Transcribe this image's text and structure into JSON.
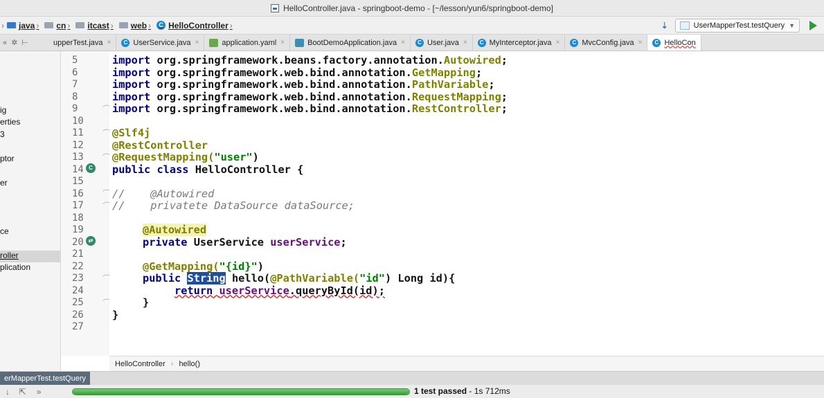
{
  "window": {
    "title": "HelloController.java - springboot-demo - [~/lesson/yun6/springboot-demo]"
  },
  "breadcrumb": [
    {
      "label": "java"
    },
    {
      "label": "cn"
    },
    {
      "label": "itcast"
    },
    {
      "label": "web"
    },
    {
      "label": "HelloController"
    }
  ],
  "run_config": {
    "label": "UserMapperTest.testQuery"
  },
  "tabs": [
    {
      "label": "upperTest.java"
    },
    {
      "label": "UserService.java"
    },
    {
      "label": "application.yaml"
    },
    {
      "label": "BootDemoApplication.java"
    },
    {
      "label": "User.java"
    },
    {
      "label": "MyInterceptor.java"
    },
    {
      "label": "MvcConfig.java"
    },
    {
      "label": "HelloCon"
    }
  ],
  "project_items": [
    {
      "label": "ig"
    },
    {
      "label": "erties"
    },
    {
      "label": "3"
    },
    {
      "label": "ptor"
    },
    {
      "label": "er"
    },
    {
      "label": "ce"
    },
    {
      "label": "roller"
    },
    {
      "label": "plication"
    }
  ],
  "line_numbers": [
    "5",
    "6",
    "7",
    "8",
    "9",
    "10",
    "11",
    "12",
    "13",
    "14",
    "15",
    "16",
    "17",
    "18",
    "19",
    "20",
    "21",
    "22",
    "23",
    "24",
    "25",
    "26",
    "27"
  ],
  "code": {
    "l5_a": "import ",
    "l5_b": "org.springframework.beans.factory.annotation.",
    "l5_c": "Autowired",
    "l5_d": ";",
    "l6_a": "import ",
    "l6_b": "org.springframework.web.bind.annotation.",
    "l6_c": "GetMapping",
    "l6_d": ";",
    "l7_a": "import ",
    "l7_b": "org.springframework.web.bind.annotation.",
    "l7_c": "PathVariable",
    "l7_d": ";",
    "l8_a": "import ",
    "l8_b": "org.springframework.web.bind.annotation.",
    "l8_c": "RequestMapping",
    "l8_d": ";",
    "l9_a": "import ",
    "l9_b": "org.springframework.web.bind.annotation.",
    "l9_c": "RestController",
    "l9_d": ";",
    "l11": "@Slf4j",
    "l12": "@RestController",
    "l13_a": "@RequestMapping(",
    "l13_b": "\"user\"",
    "l13_c": ")",
    "l14_a": "public class ",
    "l14_b": "HelloController {",
    "l16": "//    @Autowired",
    "l17": "//    privatete DataSource dataSource;",
    "l19": "@Autowired",
    "l20_a": "private ",
    "l20_b": "UserService ",
    "l20_c": "userService",
    "l20_d": ";",
    "l22_a": "@GetMapping(",
    "l22_b": "\"{id}\"",
    "l22_c": ")",
    "l23_a": "public ",
    "l23_b": "String",
    "l23_c": " hello(",
    "l23_d": "@PathVariable(",
    "l23_e": "\"id\"",
    "l23_f": ") Long id){",
    "l24_a": "return ",
    "l24_b": "userService",
    "l24_c": ".queryById(id);",
    "l25": "}",
    "l26": "}"
  },
  "editor_breadcrumb": {
    "class": "HelloController",
    "method": "hello()"
  },
  "run_tab": {
    "label": "erMapperTest.testQuery"
  },
  "status": {
    "result_bold": "1 test passed",
    "result_rest": " - 1s 712ms",
    "progress": 1.0
  },
  "colors": {
    "keyword": "#000080",
    "annotation": "#808000",
    "string": "#008000",
    "field": "#660e7a",
    "selection": "#1f4e9b",
    "pass": "#3a9e3a"
  }
}
